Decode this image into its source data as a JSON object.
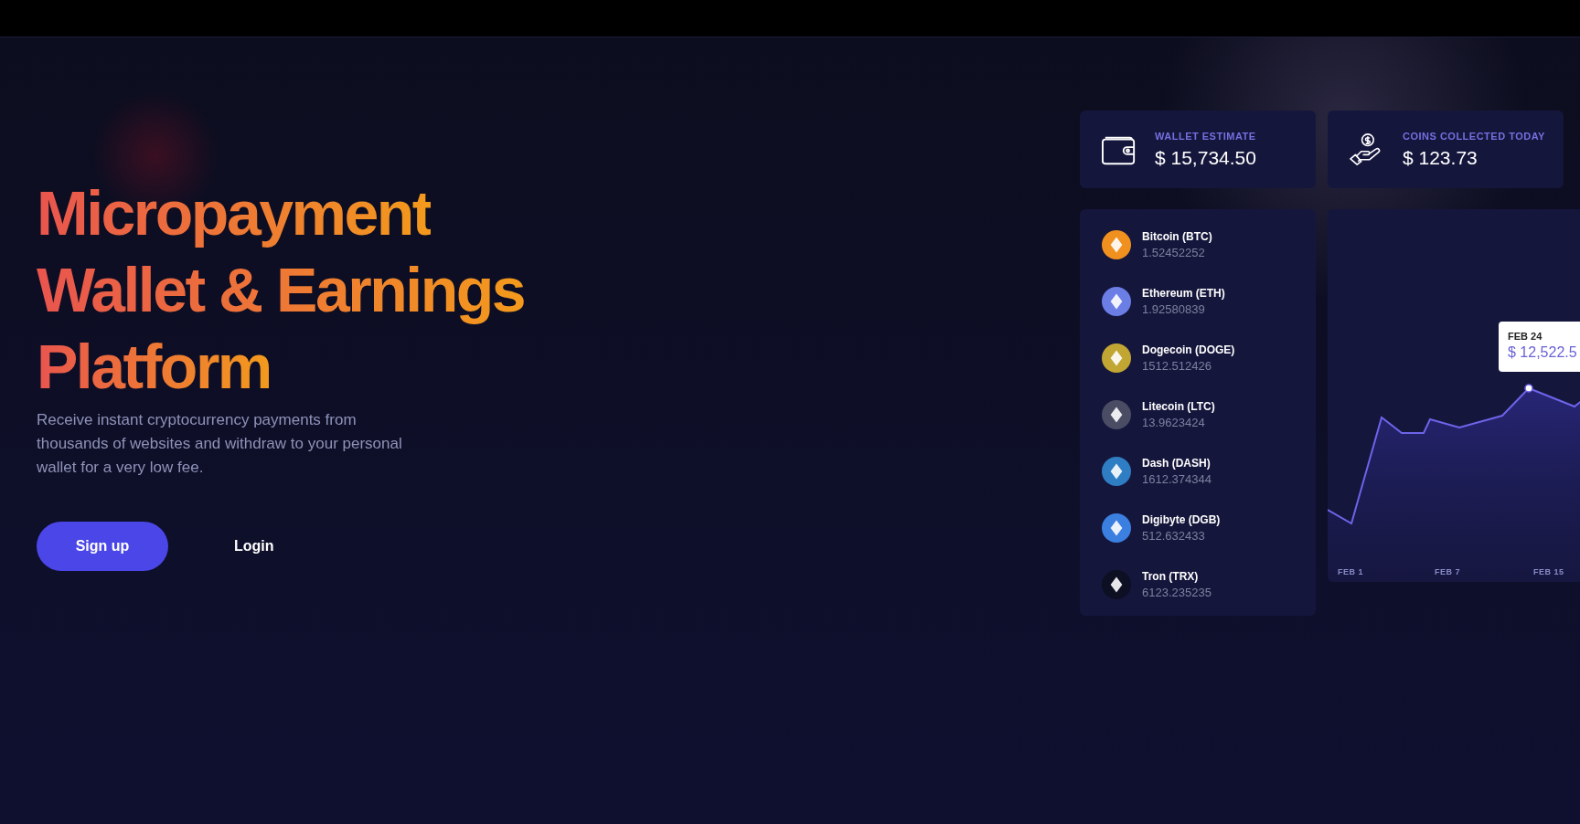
{
  "hero": {
    "title_lines": [
      "Micropayment",
      "Wallet & Earnings",
      "Platform"
    ],
    "description": "Receive instant cryptocurrency payments from thousands of websites and withdraw to your personal wallet for a very low fee.",
    "buttons": [
      {
        "label": "Sign up",
        "kind": "primary"
      },
      {
        "label": "Login",
        "kind": "plain"
      }
    ]
  },
  "stats": [
    {
      "kind": "wallet",
      "label": "WALLET ESTIMATE",
      "value": "$ 15,734.50"
    },
    {
      "kind": "hand",
      "label": "COINS COLLECTED TODAY",
      "value": "$ 123.73"
    }
  ],
  "coins": [
    {
      "name": "Bitcoin (BTC)",
      "amount": "1.52452252",
      "color": "#f0901e"
    },
    {
      "name": "Ethereum (ETH)",
      "amount": "1.92580839",
      "color": "#6a7ee6"
    },
    {
      "name": "Dogecoin (DOGE)",
      "amount": "1512.512426",
      "color": "#c2a633"
    },
    {
      "name": "Litecoin (LTC)",
      "amount": "13.9623424",
      "color": "#4a4c64"
    },
    {
      "name": "Dash (DASH)",
      "amount": "1612.374344",
      "color": "#2f7ec4"
    },
    {
      "name": "Digibyte (DGB)",
      "amount": "512.632433",
      "color": "#3b7fe0"
    },
    {
      "name": "Tron (TRX)",
      "amount": "6123.235235",
      "color": "#0d0f22"
    }
  ],
  "chart": {
    "tooltip": {
      "date": "FEB 24",
      "value": "$ 12,522.5"
    },
    "x_labels": [
      "FEB 1",
      "FEB 7",
      "FEB 15"
    ]
  }
}
